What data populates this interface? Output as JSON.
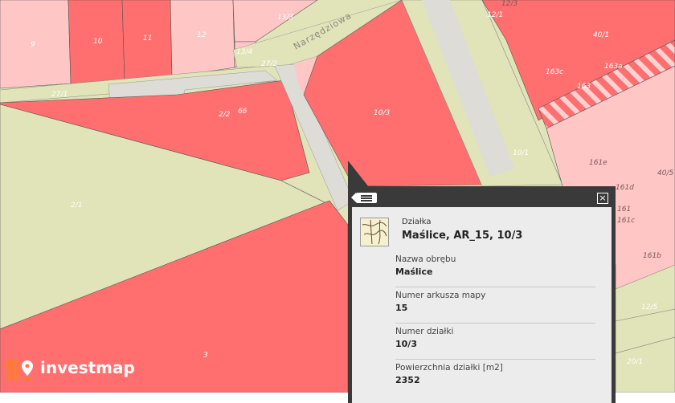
{
  "map": {
    "street_name": "Narzędziowa",
    "parcel_labels": [
      "9",
      "10",
      "11",
      "12",
      "13/3",
      "13/4",
      "27/2",
      "27/1",
      "2/2",
      "66",
      "10/3",
      "2/1",
      "3",
      "10/1",
      "12/3",
      "12/1",
      "40/1",
      "163c",
      "163a",
      "163",
      "161e",
      "161d",
      "161",
      "161c",
      "161b",
      "40/5",
      "12/5",
      "20/1"
    ]
  },
  "popup": {
    "kind": "Działka",
    "title": "Maślice, AR_15, 10/3",
    "close_symbol": "×",
    "fields": [
      {
        "key": "Nazwa obrębu",
        "value": "Maślice"
      },
      {
        "key": "Numer arkusza mapy",
        "value": "15"
      },
      {
        "key": "Numer działki",
        "value": "10/3"
      },
      {
        "key": "Powierzchnia działki [m2]",
        "value": "2352"
      }
    ]
  },
  "logo": {
    "text": "investmap"
  },
  "colors": {
    "parcel_red": "#ff6f6f",
    "parcel_pink": "#ffc6c6",
    "road_beige": "#e1e3b8",
    "popup_header": "#3a3a3a",
    "popup_body": "#ececec"
  }
}
